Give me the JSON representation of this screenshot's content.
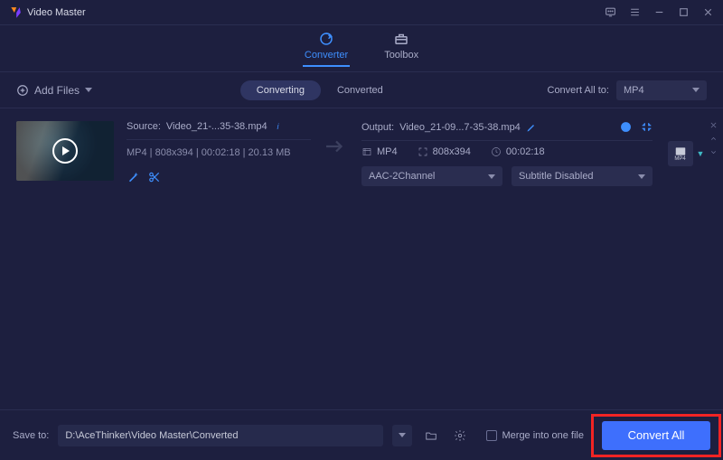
{
  "app": {
    "title": "Video Master"
  },
  "tabs": {
    "converter": "Converter",
    "toolbox": "Toolbox"
  },
  "toolbar": {
    "add_files": "Add Files",
    "converting": "Converting",
    "converted": "Converted",
    "convert_all_to_label": "Convert All to:",
    "convert_all_to_value": "MP4"
  },
  "file": {
    "source_label": "Source:",
    "source_name": "Video_21-...35-38.mp4",
    "meta": "MP4 | 808x394 | 00:02:18 | 20.13 MB",
    "output_label": "Output:",
    "output_name": "Video_21-09...7-35-38.mp4",
    "out_format": "MP4",
    "out_resolution": "808x394",
    "out_duration": "00:02:18",
    "audio_select": "AAC-2Channel",
    "subtitle_select": "Subtitle Disabled",
    "format_badge": "MP4"
  },
  "footer": {
    "save_to_label": "Save to:",
    "save_path": "D:\\AceThinker\\Video Master\\Converted",
    "merge_label": "Merge into one file",
    "convert_all_btn": "Convert All"
  }
}
